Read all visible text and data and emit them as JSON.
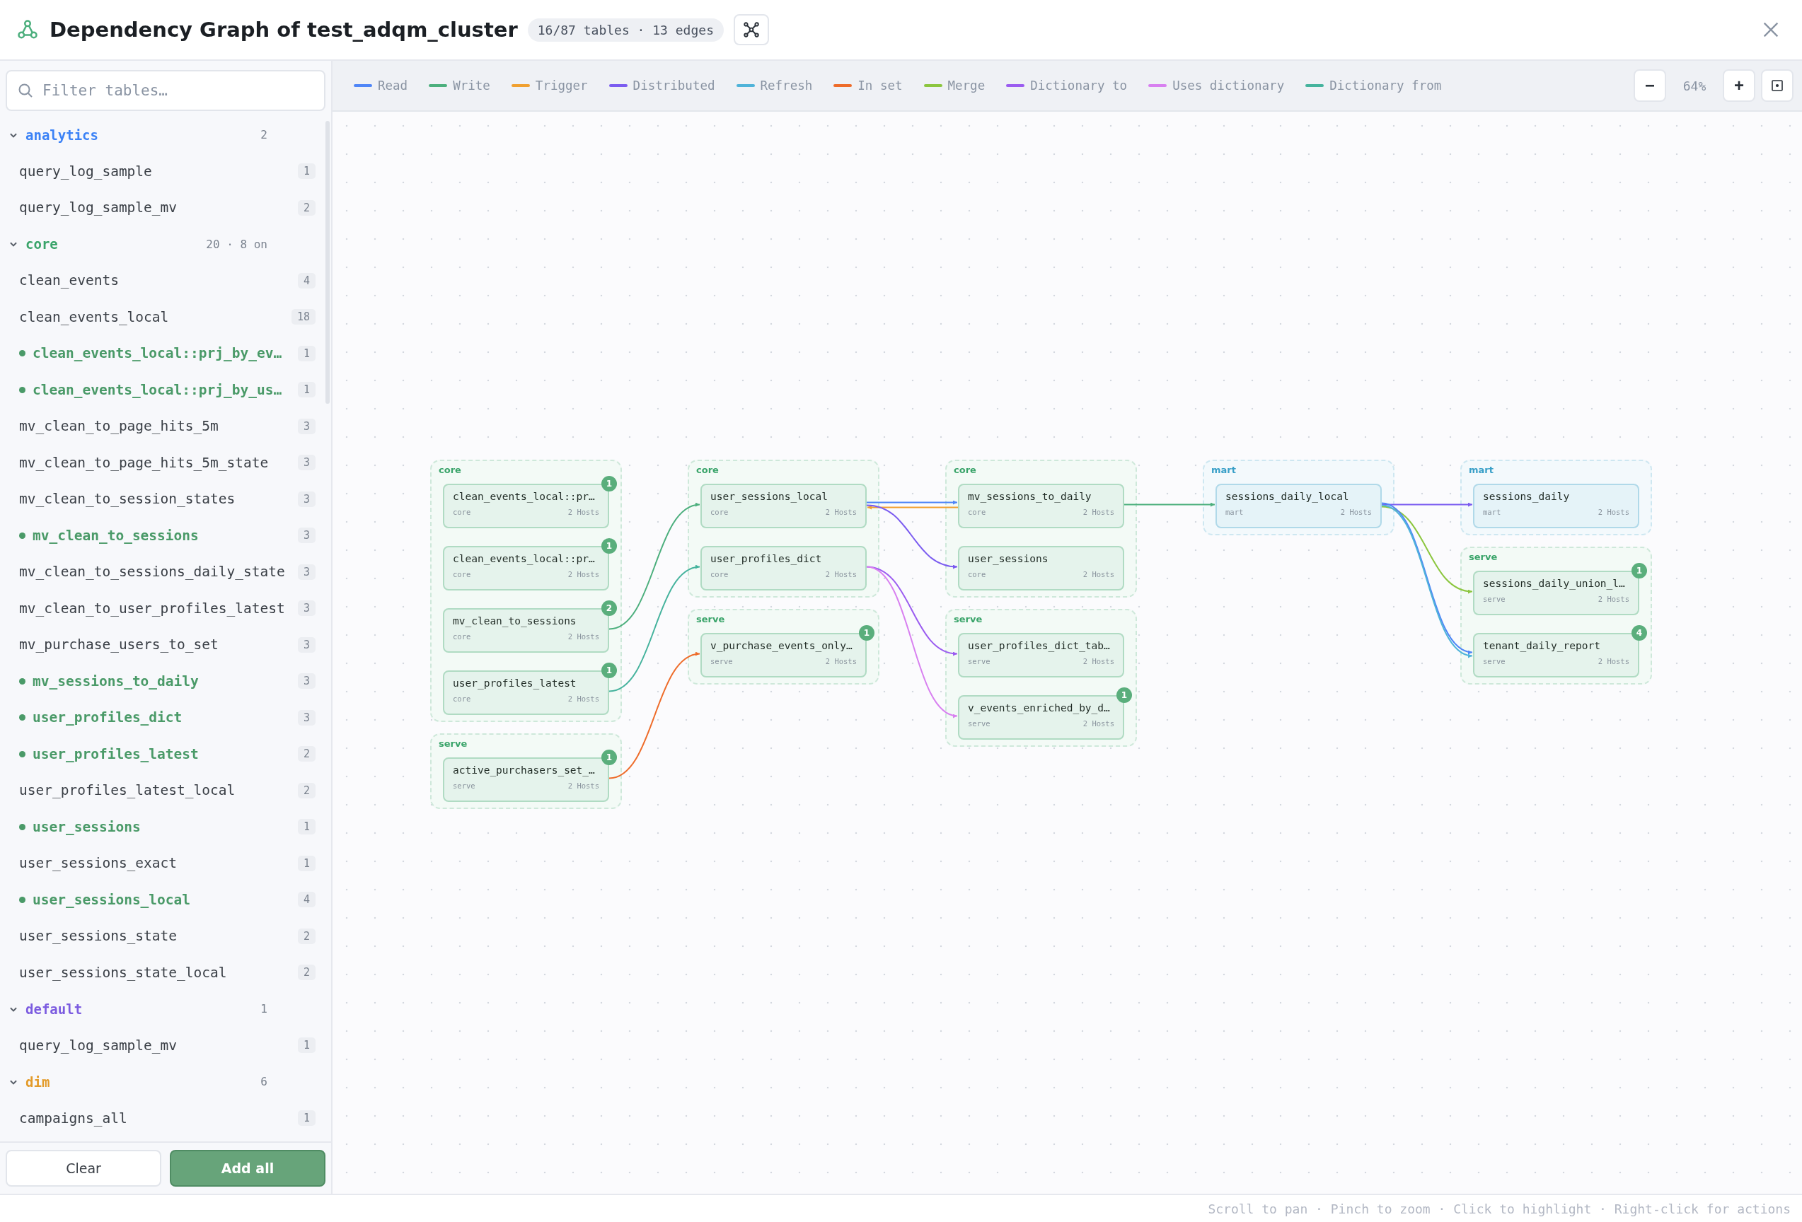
{
  "header": {
    "title": "Dependency Graph of test_adqm_cluster",
    "badge": "16/87 tables · 13 edges"
  },
  "sidebar": {
    "search": {
      "placeholder": "Filter tables…"
    },
    "groups": [
      {
        "name": "analytics",
        "color": "#3b82f6",
        "count": "2",
        "expanded": true,
        "items": [
          {
            "name": "query_log_sample",
            "count": "1",
            "selected": false
          },
          {
            "name": "query_log_sample_mv",
            "count": "2",
            "selected": false
          }
        ]
      },
      {
        "name": "core",
        "color": "#3aa46a",
        "count": "20 · 8 on",
        "expanded": true,
        "items": [
          {
            "name": "clean_events",
            "count": "4",
            "selected": false
          },
          {
            "name": "clean_events_local",
            "count": "18",
            "selected": false
          },
          {
            "name": "clean_events_local::prj_by_ev…",
            "count": "1",
            "selected": true
          },
          {
            "name": "clean_events_local::prj_by_us…",
            "count": "1",
            "selected": true
          },
          {
            "name": "mv_clean_to_page_hits_5m",
            "count": "3",
            "selected": false
          },
          {
            "name": "mv_clean_to_page_hits_5m_state",
            "count": "3",
            "selected": false
          },
          {
            "name": "mv_clean_to_session_states",
            "count": "3",
            "selected": false
          },
          {
            "name": "mv_clean_to_sessions",
            "count": "3",
            "selected": true
          },
          {
            "name": "mv_clean_to_sessions_daily_state",
            "count": "3",
            "selected": false
          },
          {
            "name": "mv_clean_to_user_profiles_latest",
            "count": "3",
            "selected": false
          },
          {
            "name": "mv_purchase_users_to_set",
            "count": "3",
            "selected": false
          },
          {
            "name": "mv_sessions_to_daily",
            "count": "3",
            "selected": true
          },
          {
            "name": "user_profiles_dict",
            "count": "3",
            "selected": true
          },
          {
            "name": "user_profiles_latest",
            "count": "2",
            "selected": true
          },
          {
            "name": "user_profiles_latest_local",
            "count": "2",
            "selected": false
          },
          {
            "name": "user_sessions",
            "count": "1",
            "selected": true
          },
          {
            "name": "user_sessions_exact",
            "count": "1",
            "selected": false
          },
          {
            "name": "user_sessions_local",
            "count": "4",
            "selected": true
          },
          {
            "name": "user_sessions_state",
            "count": "2",
            "selected": false
          },
          {
            "name": "user_sessions_state_local",
            "count": "2",
            "selected": false
          }
        ]
      },
      {
        "name": "default",
        "color": "#7c5ce0",
        "count": "1",
        "expanded": true,
        "items": [
          {
            "name": "query_log_sample_mv",
            "count": "1",
            "selected": false
          }
        ]
      },
      {
        "name": "dim",
        "color": "#e39b2a",
        "count": "6",
        "expanded": true,
        "items": [
          {
            "name": "campaigns_all",
            "count": "1",
            "selected": false
          }
        ]
      }
    ],
    "buttons": [
      {
        "label": "Clear",
        "kind": "secondary"
      },
      {
        "label": "Add all",
        "kind": "primary"
      }
    ]
  },
  "legend": [
    {
      "label": "Read",
      "color": "#4f86f7"
    },
    {
      "label": "Write",
      "color": "#4caf7d"
    },
    {
      "label": "Trigger",
      "color": "#f0a030"
    },
    {
      "label": "Distributed",
      "color": "#7b5cf0"
    },
    {
      "label": "Refresh",
      "color": "#4fb3d9"
    },
    {
      "label": "In set",
      "color": "#ee6c2a"
    },
    {
      "label": "Merge",
      "color": "#8cc63f"
    },
    {
      "label": "Dictionary to",
      "color": "#9b5cf0"
    },
    {
      "label": "Uses dictionary",
      "color": "#d880f0"
    },
    {
      "label": "Dictionary from",
      "color": "#45b39d"
    }
  ],
  "zoom": {
    "minus": "−",
    "reading": "64%",
    "plus": "+"
  },
  "graph": {
    "columns": [
      {
        "groups": [
          {
            "label": "core",
            "color": "#3aa46a",
            "nodes": [
              {
                "name": "clean_events_local::pr…",
                "schema": "core",
                "hosts": "2 Hosts",
                "badge": "1"
              },
              {
                "name": "clean_events_local::pr…",
                "schema": "core",
                "hosts": "2 Hosts",
                "badge": "1"
              },
              {
                "name": "mv_clean_to_sessions",
                "schema": "core",
                "hosts": "2 Hosts",
                "badge": "2"
              },
              {
                "name": "user_profiles_latest",
                "schema": "core",
                "hosts": "2 Hosts",
                "badge": "1"
              }
            ]
          },
          {
            "label": "serve",
            "color": "#3aa46a",
            "nodes": [
              {
                "name": "active_purchasers_set_…",
                "schema": "serve",
                "hosts": "2 Hosts",
                "badge": "1"
              }
            ]
          }
        ]
      },
      {
        "groups": [
          {
            "label": "core",
            "color": "#3aa46a",
            "nodes": [
              {
                "name": "user_sessions_local",
                "schema": "core",
                "hosts": "2 Hosts"
              },
              {
                "name": "user_profiles_dict",
                "schema": "core",
                "hosts": "2 Hosts"
              }
            ]
          },
          {
            "label": "serve",
            "color": "#3aa46a",
            "nodes": [
              {
                "name": "v_purchase_events_only…",
                "schema": "serve",
                "hosts": "2 Hosts",
                "badge": "1"
              }
            ]
          }
        ]
      },
      {
        "groups": [
          {
            "label": "core",
            "color": "#3aa46a",
            "nodes": [
              {
                "name": "mv_sessions_to_daily",
                "schema": "core",
                "hosts": "2 Hosts"
              },
              {
                "name": "user_sessions",
                "schema": "core",
                "hosts": "2 Hosts"
              }
            ]
          },
          {
            "label": "serve",
            "color": "#3aa46a",
            "nodes": [
              {
                "name": "user_profiles_dict_tab…",
                "schema": "serve",
                "hosts": "2 Hosts"
              },
              {
                "name": "v_events_enriched_by_d…",
                "schema": "serve",
                "hosts": "2 Hosts",
                "badge": "1"
              }
            ]
          }
        ]
      },
      {
        "groups": [
          {
            "label": "mart",
            "color": "#3aa0c8",
            "nodes": [
              {
                "name": "sessions_daily_local",
                "schema": "mart",
                "hosts": "2 Hosts"
              }
            ]
          }
        ]
      },
      {
        "groups": [
          {
            "label": "mart",
            "color": "#3aa0c8",
            "nodes": [
              {
                "name": "sessions_daily",
                "schema": "mart",
                "hosts": "2 Hosts"
              }
            ]
          },
          {
            "label": "serve",
            "color": "#3aa46a",
            "nodes": [
              {
                "name": "sessions_daily_union_l…",
                "schema": "serve",
                "hosts": "2 Hosts",
                "badge": "1"
              },
              {
                "name": "tenant_daily_report",
                "schema": "serve",
                "hosts": "2 Hosts",
                "badge": "4"
              }
            ]
          }
        ]
      }
    ]
  },
  "hint": "Scroll to pan · Pinch to zoom · Click to highlight · Right-click for actions"
}
